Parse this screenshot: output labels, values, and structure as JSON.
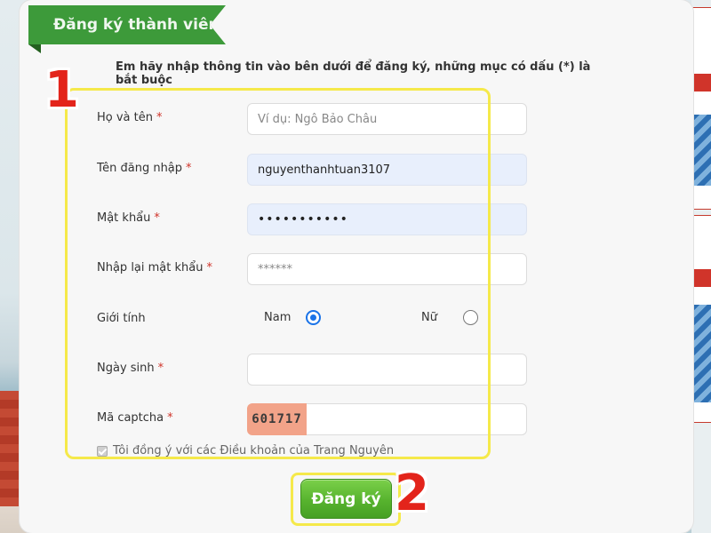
{
  "header": {
    "title": "Đăng ký thành viên"
  },
  "instruction": "Em hãy nhập thông tin vào bên dưới để đăng ký, những mục có dấu (*) là bắt buộc",
  "required_mark": "*",
  "form": {
    "fullname": {
      "label": "Họ và tên",
      "placeholder": "Ví dụ: Ngô Bảo Châu",
      "value": ""
    },
    "username": {
      "label": "Tên đăng nhập",
      "value": "nguyenthanhtuan3107"
    },
    "password": {
      "label": "Mật khẩu",
      "value": "•••••••••••"
    },
    "password_confirm": {
      "label": "Nhập lại mật khẩu",
      "placeholder": "******",
      "value": ""
    },
    "gender": {
      "label": "Giới tính",
      "options": [
        "Nam",
        "Nữ"
      ],
      "selected": "Nam"
    },
    "birthday": {
      "label": "Ngày sinh",
      "value": ""
    },
    "captcha": {
      "label": "Mã captcha",
      "code": "601717",
      "value": ""
    },
    "agree": {
      "label": "Tôi đồng ý với các Điều khoản của Trang Nguyên",
      "checked": true
    }
  },
  "submit_label": "Đăng ký",
  "annotations": {
    "step1": "1",
    "step2": "2"
  },
  "colors": {
    "ribbon": "#3d9a3a",
    "required": "#d0342a",
    "button": "#57b32e",
    "highlight": "#f5e94a",
    "marker": "#e3241b"
  }
}
